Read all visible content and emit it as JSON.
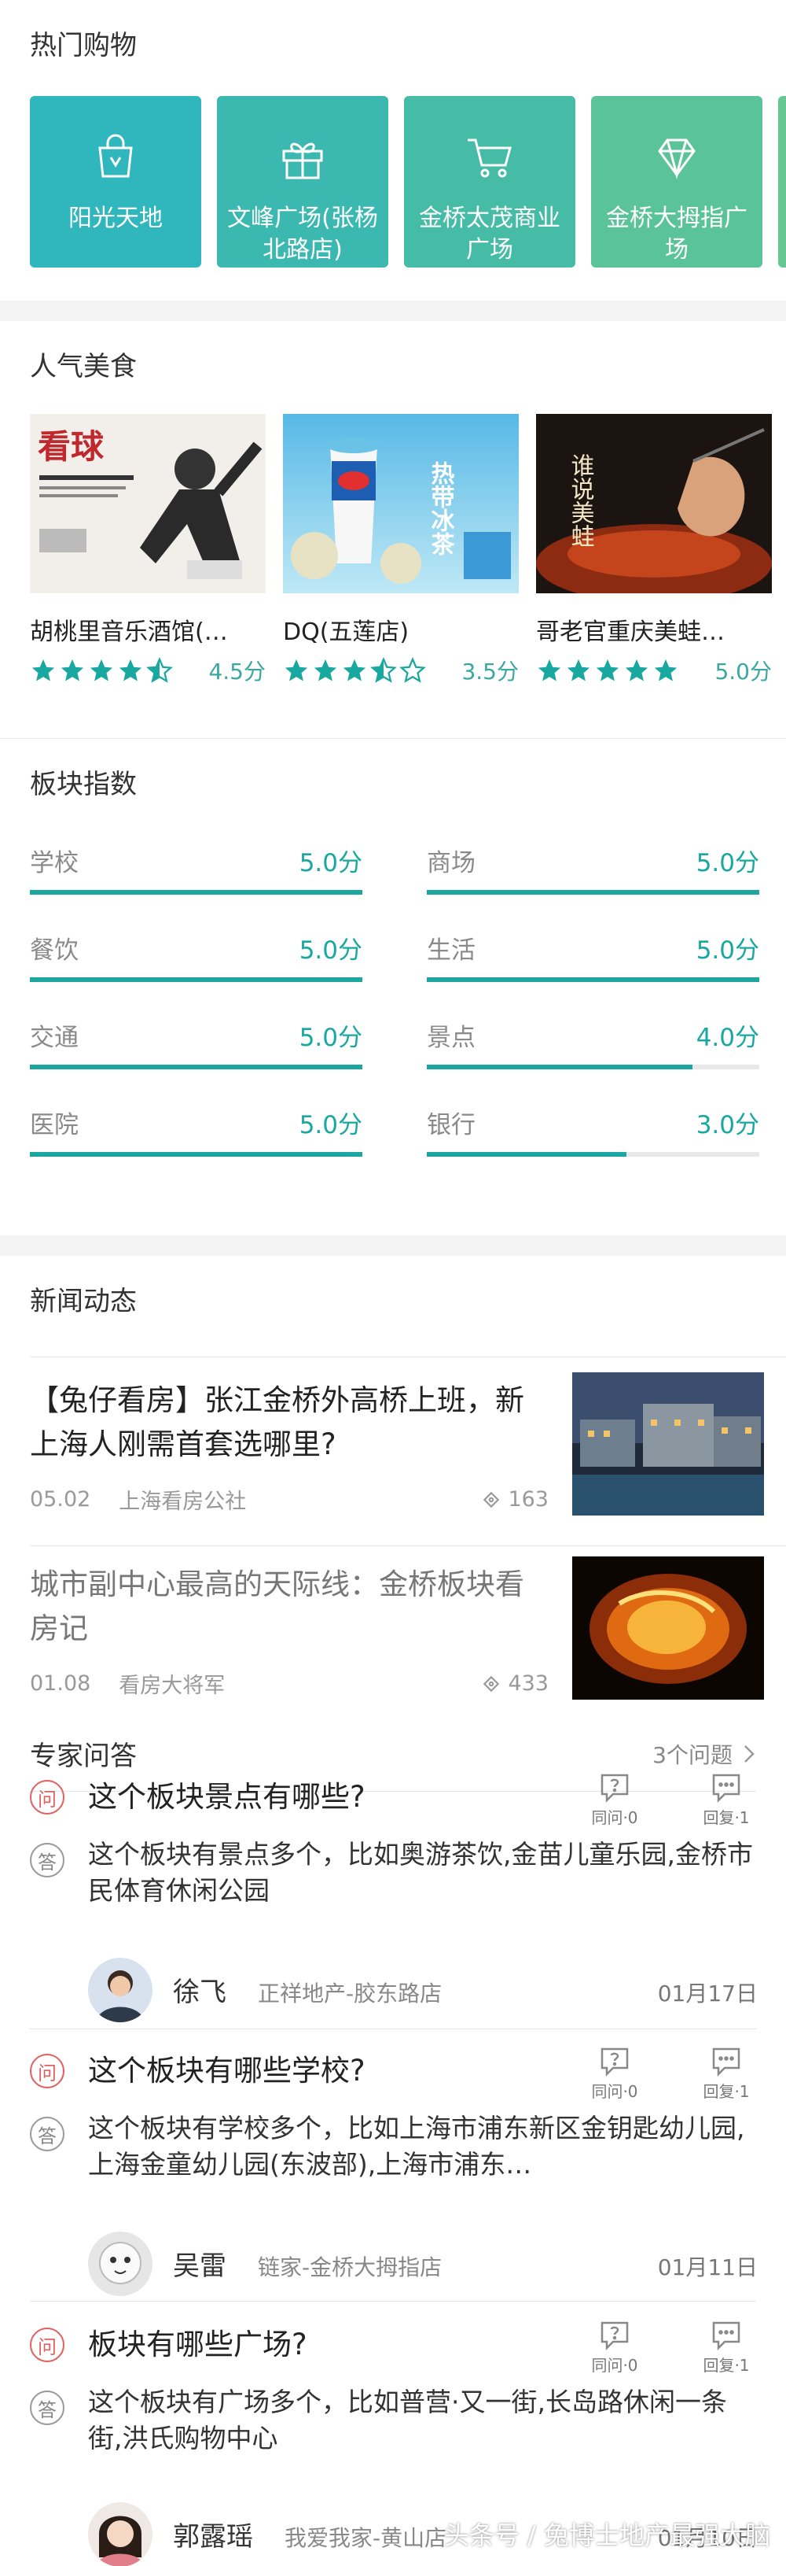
{
  "shopping": {
    "title": "热门购物",
    "cards": [
      {
        "label": "阳光天地",
        "icon": "shopping-bag-icon",
        "color": "#30b7bd"
      },
      {
        "label": "文峰广场(张杨北路店)",
        "icon": "gift-icon",
        "color": "#3bb8b0"
      },
      {
        "label": "金桥太茂商业广场",
        "icon": "cart-icon",
        "color": "#46bba5"
      },
      {
        "label": "金桥大拇指广场",
        "icon": "diamond-icon",
        "color": "#5bc39a"
      }
    ]
  },
  "food": {
    "title": "人气美食",
    "items": [
      {
        "name": "胡桃里音乐酒馆(…",
        "rating": 4.5,
        "score": "4.5分"
      },
      {
        "name": "DQ(五莲店)",
        "rating": 3.5,
        "score": "3.5分"
      },
      {
        "name": "哥老官重庆美蛙…",
        "rating": 5.0,
        "score": "5.0分"
      }
    ],
    "poster1_text": "看球",
    "poster2_text": "热带冰茶",
    "poster3_text": "谁说美蛙"
  },
  "index": {
    "title": "板块指数",
    "items": [
      {
        "name": "学校",
        "value": "5.0分",
        "level": 1.0
      },
      {
        "name": "商场",
        "value": "5.0分",
        "level": 1.0
      },
      {
        "name": "餐饮",
        "value": "5.0分",
        "level": 1.0
      },
      {
        "name": "生活",
        "value": "5.0分",
        "level": 1.0
      },
      {
        "name": "交通",
        "value": "5.0分",
        "level": 1.0
      },
      {
        "name": "景点",
        "value": "4.0分",
        "level": 0.8
      },
      {
        "name": "医院",
        "value": "5.0分",
        "level": 1.0
      },
      {
        "name": "银行",
        "value": "3.0分",
        "level": 0.6
      }
    ]
  },
  "news": {
    "title": "新闻动态",
    "items": [
      {
        "title": "【兔仔看房】张江金桥外高桥上班，新上海人刚需首套选哪里?",
        "date": "05.02",
        "source": "上海看房公社",
        "views": "163"
      },
      {
        "title": "城市副中心最高的天际线：金桥板块看房记",
        "date": "01.08",
        "source": "看房大将军",
        "views": "433"
      }
    ]
  },
  "qa": {
    "title": "专家问答",
    "count": "3个问题",
    "q_badge": "问",
    "a_badge": "答",
    "same_q_label": "同问·0",
    "reply_label": "回复·1",
    "items": [
      {
        "question": "这个板块景点有哪些?",
        "answer": "这个板块有景点多个，比如奥游茶饮,金苗儿童乐园,金桥市民体育休闲公园",
        "user": "徐飞",
        "company": "正祥地产-胶东路店",
        "date": "01月17日"
      },
      {
        "question": "这个板块有哪些学校?",
        "answer": "这个板块有学校多个，比如上海市浦东新区金钥匙幼儿园,上海金童幼儿园(东波部),上海市浦东…",
        "user": "吴雷",
        "company": "链家-金桥大拇指店",
        "date": "01月11日"
      },
      {
        "question": "板块有哪些广场?",
        "answer": "这个板块有广场多个，比如普营·又一街,长岛路休闲一条街,洪氏购物中心",
        "user": "郭露瑶",
        "company": "我爱我家-黄山店",
        "date": "01月10日"
      }
    ]
  },
  "watermark": "头条号 / 兔博士地产最强大脑"
}
